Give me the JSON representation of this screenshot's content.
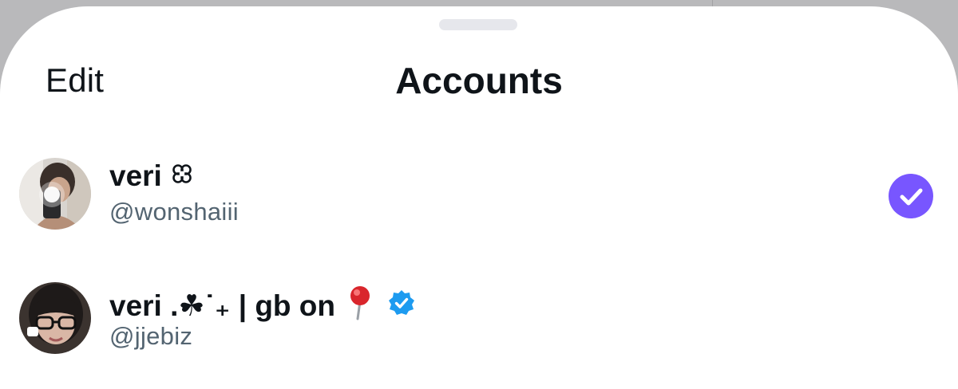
{
  "header": {
    "edit_label": "Edit",
    "title": "Accounts"
  },
  "accounts": [
    {
      "display_name": "veri",
      "name_symbol": "flower-outline-icon",
      "handle": "@wonshaiii",
      "selected": true
    },
    {
      "display_name": "veri .☘︎˙₊ | gb on",
      "name_symbol": "round-pushpin-icon",
      "verified": true,
      "handle": "@jjebiz",
      "selected": false
    }
  ],
  "colors": {
    "accent_selected": "#7856ff",
    "verified_badge": "#1d9bf0",
    "text_primary": "#0f1419",
    "text_secondary": "#536471"
  }
}
